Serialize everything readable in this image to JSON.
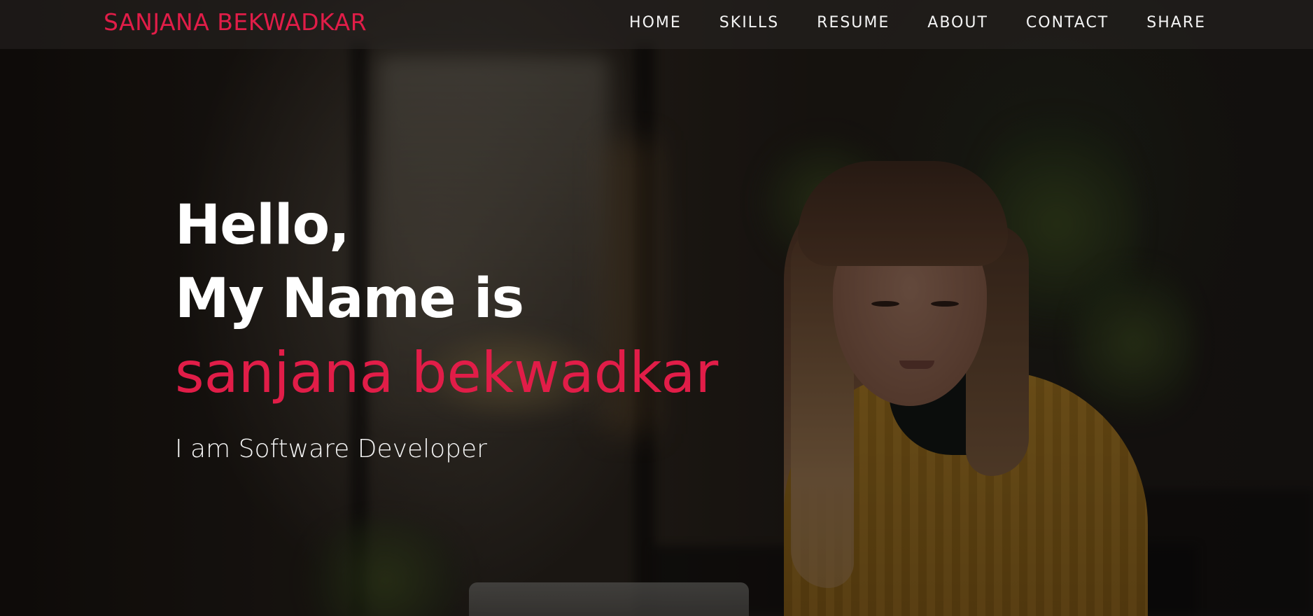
{
  "brand": {
    "name": "SANJANA BEKWADKAR",
    "color": "#e11d48"
  },
  "nav": {
    "items": [
      {
        "label": "HOME"
      },
      {
        "label": "SKILLS"
      },
      {
        "label": "RESUME"
      },
      {
        "label": "ABOUT"
      },
      {
        "label": "CONTACT"
      },
      {
        "label": "SHARE"
      }
    ]
  },
  "hero": {
    "greeting": "Hello,",
    "intro": "My Name is",
    "name": "sanjana bekwadkar",
    "role": "I am Software Developer",
    "accent_color": "#e11d48",
    "background_image": "woman in yellow sweater working on laptop"
  }
}
